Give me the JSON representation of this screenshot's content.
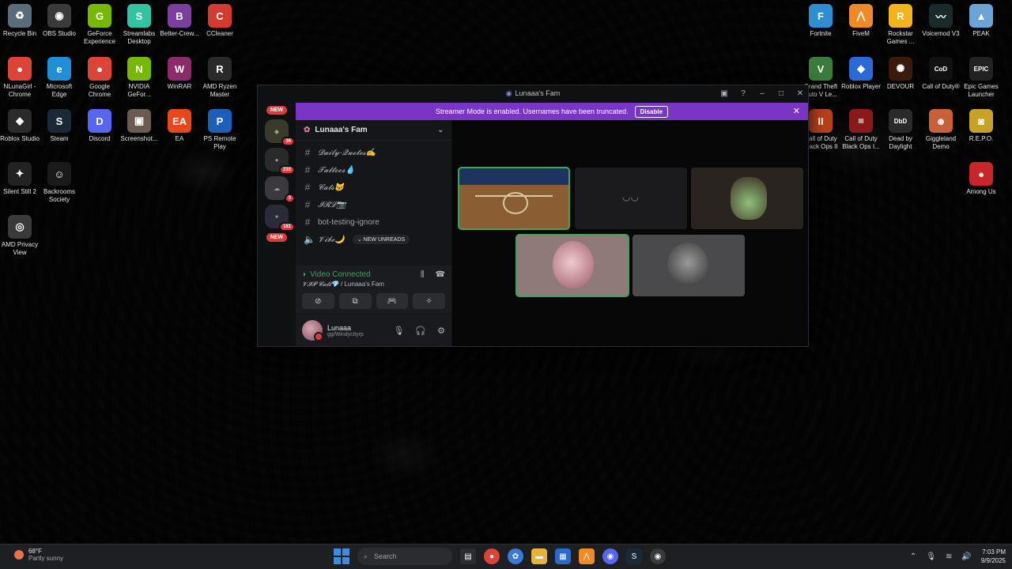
{
  "desktop_icons_left": [
    {
      "label": "Recycle Bin",
      "icon": "recycle-bin-icon",
      "color": "#5a6b7a",
      "glyph": "♻"
    },
    {
      "label": "OBS Studio",
      "icon": "obs-icon",
      "color": "#3a3a3a",
      "glyph": "◉"
    },
    {
      "label": "GeForce Experience",
      "icon": "geforce-icon",
      "color": "#76b900",
      "glyph": "G"
    },
    {
      "label": "Streamlabs Desktop",
      "icon": "streamlabs-icon",
      "color": "#31c3a2",
      "glyph": "S"
    },
    {
      "label": "Better-Crew...",
      "icon": "bettercrew-icon",
      "color": "#7b3fa0",
      "glyph": "B"
    },
    {
      "label": "CCleaner",
      "icon": "ccleaner-icon",
      "color": "#d33b2f",
      "glyph": "C"
    },
    {
      "label": "NLunaGirl - Chrome",
      "icon": "chrome-icon",
      "color": "#db4437",
      "glyph": "●"
    },
    {
      "label": "Microsoft Edge",
      "icon": "edge-icon",
      "color": "#1f8fd6",
      "glyph": "e"
    },
    {
      "label": "Google Chrome",
      "icon": "chrome-icon",
      "color": "#db4437",
      "glyph": "●"
    },
    {
      "label": "NVIDIA GeFor...",
      "icon": "nvidia-icon",
      "color": "#76b900",
      "glyph": "N"
    },
    {
      "label": "WinRAR",
      "icon": "winrar-icon",
      "color": "#8c2a6a",
      "glyph": "W"
    },
    {
      "label": "AMD Ryzen Master",
      "icon": "ryzen-icon",
      "color": "#2a2a2a",
      "glyph": "R"
    },
    {
      "label": "Roblox Studio",
      "icon": "roblox-studio-icon",
      "color": "#2b2b2b",
      "glyph": "◆"
    },
    {
      "label": "Steam",
      "icon": "steam-icon",
      "color": "#1b2838",
      "glyph": "S"
    },
    {
      "label": "Discord",
      "icon": "discord-icon",
      "color": "#5865f2",
      "glyph": "D"
    },
    {
      "label": "Screenshot...",
      "icon": "screenshot-icon",
      "color": "#6a5a52",
      "glyph": "▣"
    },
    {
      "label": "EA",
      "icon": "ea-icon",
      "color": "#e8471c",
      "glyph": "EA"
    },
    {
      "label": "PS Remote Play",
      "icon": "ps-remote-icon",
      "color": "#1d5fb8",
      "glyph": "P"
    },
    {
      "label": "Silent Still 2",
      "icon": "silent-still-icon",
      "color": "#222222",
      "glyph": "✦"
    },
    {
      "label": "Backrooms Society",
      "icon": "backrooms-icon",
      "color": "#1a1a1a",
      "glyph": "☺"
    },
    {
      "label": "AMD Privacy View",
      "icon": "amd-privacy-icon",
      "color": "#3a3a3a",
      "glyph": "◎"
    }
  ],
  "desktop_icons_right": [
    {
      "label": "Fortnite",
      "icon": "fortnite-icon",
      "color": "#2d8ed6",
      "glyph": "F"
    },
    {
      "label": "FiveM",
      "icon": "fivem-icon",
      "color": "#f08a24",
      "glyph": "⋀"
    },
    {
      "label": "Rockstar Games ...",
      "icon": "rockstar-icon",
      "color": "#f3b41b",
      "glyph": "R"
    },
    {
      "label": "Voicemod V3",
      "icon": "voicemod-icon",
      "color": "#1a2a2a",
      "glyph": "〰"
    },
    {
      "label": "PEAK",
      "icon": "peak-icon",
      "color": "#6aa5d6",
      "glyph": "▲"
    },
    {
      "label": "Grand Theft Auto V Le...",
      "icon": "gta-icon",
      "color": "#3a7a3a",
      "glyph": "V"
    },
    {
      "label": "Roblox Player",
      "icon": "roblox-icon",
      "color": "#2b6ad6",
      "glyph": "◆"
    },
    {
      "label": "DEVOUR",
      "icon": "devour-icon",
      "color": "#3a1a0a",
      "glyph": "✺"
    },
    {
      "label": "Call of Duty®",
      "icon": "cod-icon",
      "color": "#111111",
      "glyph": "CoD"
    },
    {
      "label": "Epic Games Launcher",
      "icon": "epic-icon",
      "color": "#222222",
      "glyph": "EPIC"
    },
    {
      "label": "Call of Duty Black Ops II",
      "icon": "cod-bo2-icon",
      "color": "#b8401a",
      "glyph": "II"
    },
    {
      "label": "Call of Duty Black Ops I...",
      "icon": "cod-bo-icon",
      "color": "#8a1a1a",
      "glyph": "III"
    },
    {
      "label": "Dead by Daylight",
      "icon": "dbd-icon",
      "color": "#2a2a2a",
      "glyph": "DbD"
    },
    {
      "label": "Giggleland Demo",
      "icon": "giggleland-icon",
      "color": "#c8603a",
      "glyph": "☻"
    },
    {
      "label": "R.E.P.O.",
      "icon": "repo-icon",
      "color": "#c8a12a",
      "glyph": "◙"
    },
    {
      "label": "Among Us",
      "icon": "among-us-icon",
      "color": "#c8262a",
      "glyph": "●"
    }
  ],
  "discord": {
    "window_title": "Lunaaa's Fam",
    "banner_text": "Streamer Mode is enabled. Usernames have been truncated.",
    "banner_button": "Disable",
    "guild_new_top": "NEW",
    "guild_new_bottom": "NEW",
    "guild_badges": [
      "36",
      "216",
      "3",
      "181"
    ],
    "server_name": "Lunaaa's Fam",
    "channels": [
      {
        "name": "𝓓𝓪𝓲𝓵𝔂-𝓠𝓾𝓸𝓽𝓮𝓼✍️",
        "type": "text",
        "fancy": true
      },
      {
        "name": "𝓣𝓪𝓽𝓽𝓸𝓸𝓼💧",
        "type": "text",
        "fancy": true
      },
      {
        "name": "𝓒𝓪𝓽𝓼🐱",
        "type": "text",
        "fancy": true
      },
      {
        "name": "𝓘𝓡𝓛📷",
        "type": "text",
        "fancy": true
      },
      {
        "name": "bot-testing-ignore",
        "type": "text",
        "fancy": false
      },
      {
        "name": "𝓥𝓲𝓫𝓮🌙",
        "type": "voice",
        "fancy": true
      }
    ],
    "new_unreads": "NEW UNREADS",
    "voice_status": "Video Connected",
    "voice_channel": "𝓥𝓘𝓟 𝓒𝓪𝓵𝓵💎",
    "voice_server": " / Lunaaa's Fam",
    "user_name": "Lunaaa",
    "user_status": "gg/Windycityrp"
  },
  "taskbar": {
    "weather_temp": "68°F",
    "weather_desc": "Partly sunny",
    "search_placeholder": "Search",
    "time": "7:03 PM",
    "date": "9/9/2025"
  }
}
